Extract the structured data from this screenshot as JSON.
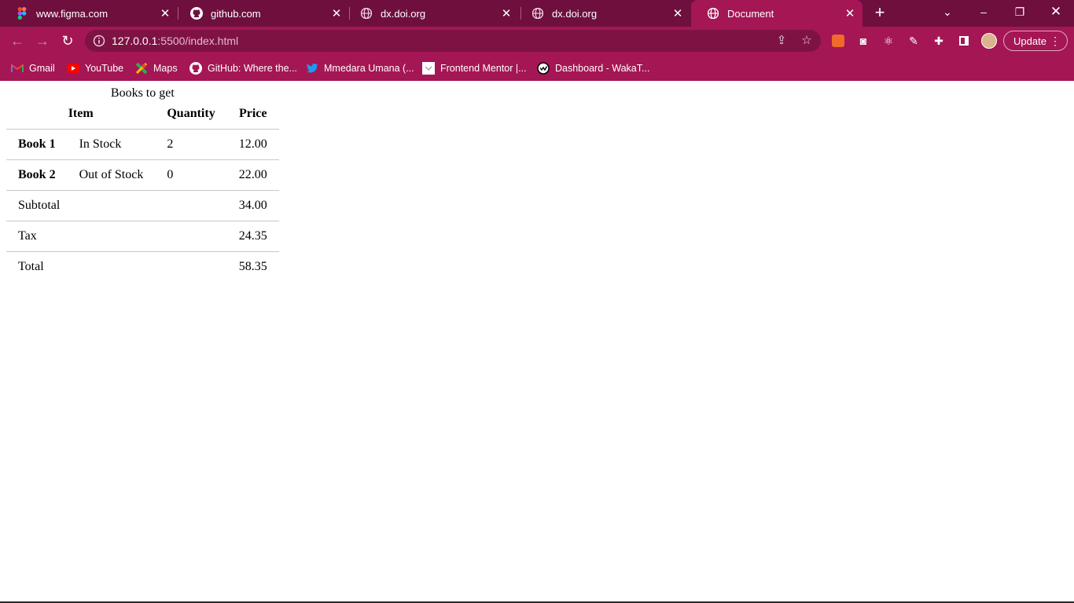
{
  "browser": {
    "tabs": [
      {
        "title": "www.figma.com",
        "icon": "figma-icon",
        "active": false
      },
      {
        "title": "github.com",
        "icon": "github-icon",
        "active": false
      },
      {
        "title": "dx.doi.org",
        "icon": "globe-icon",
        "active": false
      },
      {
        "title": "dx.doi.org",
        "icon": "globe-icon",
        "active": false
      },
      {
        "title": "Document",
        "icon": "globe-icon",
        "active": true
      }
    ],
    "url_host": "127.0.0.1",
    "url_rest": ":5500/index.html",
    "update_label": "Update",
    "bookmarks": [
      {
        "label": "Gmail",
        "icon": "gmail-icon"
      },
      {
        "label": "YouTube",
        "icon": "youtube-icon"
      },
      {
        "label": "Maps",
        "icon": "maps-icon"
      },
      {
        "label": "GitHub: Where the...",
        "icon": "github-icon"
      },
      {
        "label": "Mmedara Umana (...",
        "icon": "twitter-icon"
      },
      {
        "label": "Frontend Mentor |...",
        "icon": "frontend-mentor-icon"
      },
      {
        "label": "Dashboard - WakaT...",
        "icon": "wakatime-icon"
      }
    ],
    "colors": {
      "frame": "#a41654",
      "tabstrip": "#6e0f3d",
      "omnibox": "#7e1343"
    }
  },
  "page": {
    "caption": "Books to get",
    "headers": {
      "item": "Item",
      "quantity": "Quantity",
      "price": "Price"
    },
    "rows": [
      {
        "name": "Book 1",
        "status": "In Stock",
        "quantity": "2",
        "price": "12.00"
      },
      {
        "name": "Book 2",
        "status": "Out of Stock",
        "quantity": "0",
        "price": "22.00"
      }
    ],
    "summary": [
      {
        "label": "Subtotal",
        "price": "34.00"
      },
      {
        "label": "Tax",
        "price": "24.35"
      },
      {
        "label": "Total",
        "price": "58.35"
      }
    ]
  }
}
